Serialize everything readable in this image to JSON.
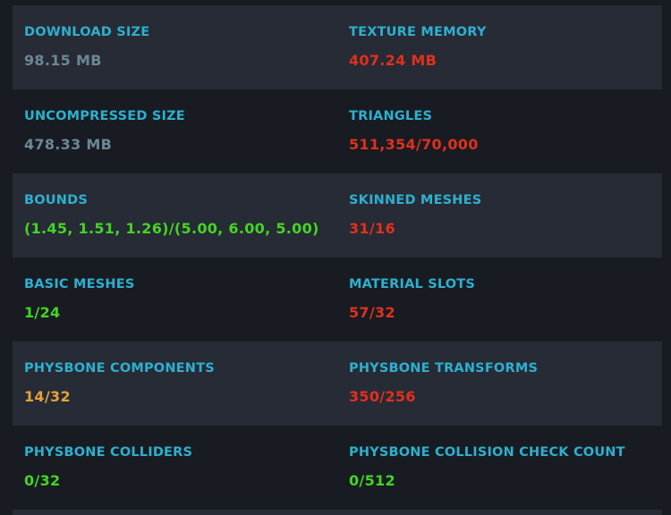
{
  "colors": {
    "label": "#2db0cf",
    "neutral": "#6b8796",
    "bad": "#e0301e",
    "good": "#45d424",
    "warn": "#e4a23a",
    "row_dark": "#272b35",
    "row_light": "#181c22"
  },
  "stats": [
    {
      "left": {
        "label": "DOWNLOAD SIZE",
        "value": "98.15 MB",
        "status": "neutral"
      },
      "right": {
        "label": "TEXTURE MEMORY",
        "value": "407.24 MB",
        "status": "bad"
      }
    },
    {
      "left": {
        "label": "UNCOMPRESSED SIZE",
        "value": "478.33 MB",
        "status": "neutral"
      },
      "right": {
        "label": "TRIANGLES",
        "value": "511,354/70,000",
        "status": "bad"
      }
    },
    {
      "left": {
        "label": "BOUNDS",
        "value": "(1.45, 1.51, 1.26)/(5.00, 6.00, 5.00)",
        "status": "good"
      },
      "right": {
        "label": "SKINNED MESHES",
        "value": "31/16",
        "status": "bad"
      }
    },
    {
      "left": {
        "label": "BASIC MESHES",
        "value": "1/24",
        "status": "good"
      },
      "right": {
        "label": "MATERIAL SLOTS",
        "value": "57/32",
        "status": "bad"
      }
    },
    {
      "left": {
        "label": "PHYSBONE COMPONENTS",
        "value": "14/32",
        "status": "warn"
      },
      "right": {
        "label": "PHYSBONE TRANSFORMS",
        "value": "350/256",
        "status": "bad"
      }
    },
    {
      "left": {
        "label": "PHYSBONE COLLIDERS",
        "value": "0/32",
        "status": "good"
      },
      "right": {
        "label": "PHYSBONE COLLISION CHECK COUNT",
        "value": "0/512",
        "status": "good"
      }
    }
  ]
}
